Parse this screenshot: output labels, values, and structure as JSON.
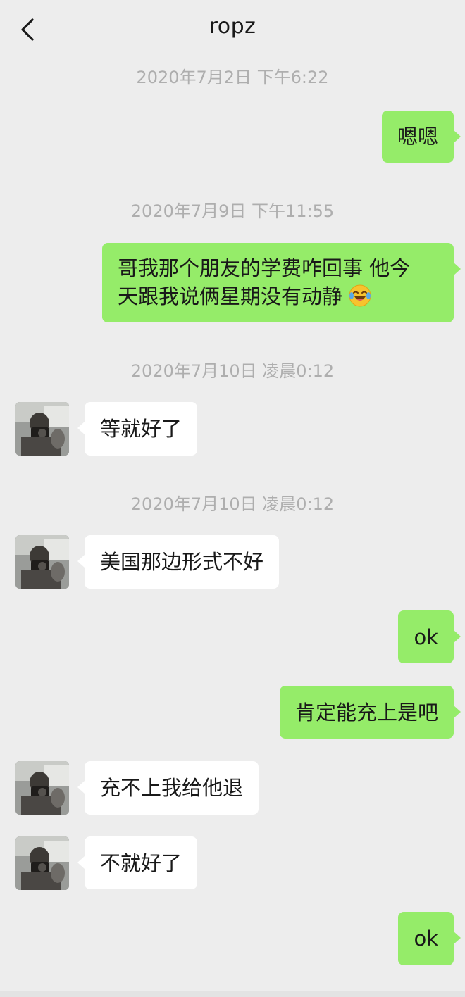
{
  "header": {
    "title": "ropz",
    "back_icon": "chevron-left-icon"
  },
  "colors": {
    "sent_bubble": "#95ec69",
    "received_bubble": "#ffffff",
    "background": "#ededed",
    "timestamp": "#aeaeae"
  },
  "messages": [
    {
      "type": "timestamp",
      "text": "2020年7月2日 下午6:22"
    },
    {
      "type": "sent",
      "text": "嗯嗯"
    },
    {
      "type": "timestamp",
      "text": "2020年7月9日 下午11:55"
    },
    {
      "type": "sent",
      "line1": "哥我那个朋友的学费咋回事 他今",
      "line2": "天跟我说俩星期没有动静",
      "emoji": "laughing-tears-emoji"
    },
    {
      "type": "timestamp",
      "text": "2020年7月10日 凌晨0:12"
    },
    {
      "type": "received",
      "text": "等就好了"
    },
    {
      "type": "timestamp",
      "text": "2020年7月10日 凌晨0:12"
    },
    {
      "type": "received",
      "text": "美国那边形式不好"
    },
    {
      "type": "sent",
      "text": "ok"
    },
    {
      "type": "sent",
      "text": "肯定能充上是吧"
    },
    {
      "type": "received",
      "text": "充不上我给他退"
    },
    {
      "type": "received",
      "text": "不就好了"
    },
    {
      "type": "sent",
      "text": "ok"
    }
  ]
}
